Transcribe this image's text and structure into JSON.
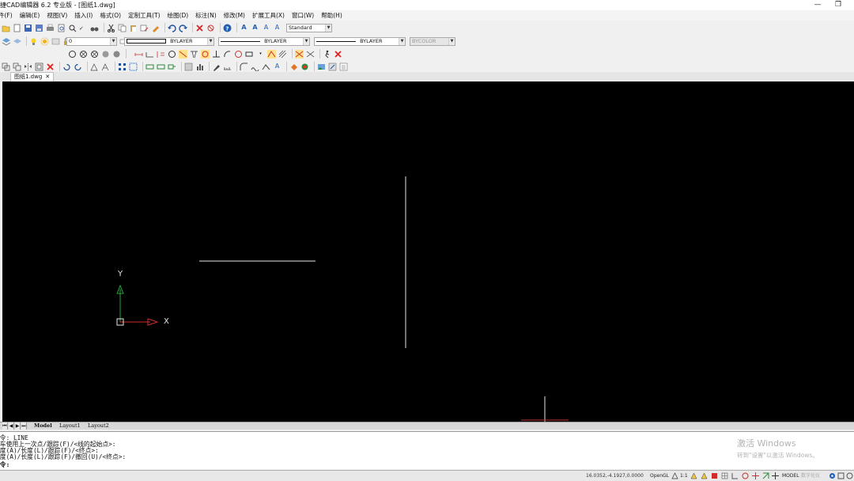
{
  "titlebar": {
    "title": "捷CAD编辑器 6.2 专业版 - [图纸1.dwg]",
    "minimize_label": "—",
    "restore_label": "❐"
  },
  "menus": [
    "件(F)",
    "编辑(E)",
    "视图(V)",
    "插入(I)",
    "格式(O)",
    "定制工具(T)",
    "绘图(D)",
    "标注(N)",
    "修改(M)",
    "扩展工具(X)",
    "窗口(W)",
    "帮助(H)"
  ],
  "toolbar1": {
    "text_style_value": "Standard"
  },
  "toolbar2": {
    "layer_value": "0",
    "color_value": "BYLAYER",
    "linetype_value": "BYLAYER",
    "lineweight_value": "BYLAYER",
    "plotstyle_value": "BYCOLOR"
  },
  "doc_tab": {
    "label": "图纸1.dwg",
    "close": "✕"
  },
  "ucs": {
    "x_label": "X",
    "y_label": "Y"
  },
  "layout_tabs": {
    "tabs": [
      "Model",
      "Layout1",
      "Layout2"
    ],
    "active": "Model"
  },
  "command": {
    "history": [
      "命令:   LINE",
      "回车使用上一次点/跟踪(F)/<线的起始点>:",
      "角度(A)/长度(L)/跟踪(F)/<终点>:",
      "角度(A)/长度(L)/跟踪(F)/撤回(U)/<终点>:"
    ],
    "prompt": "命令:"
  },
  "watermark": {
    "line1": "激活 Windows",
    "line2": "转到\"设置\"以激活 Windows。"
  },
  "statusbar": {
    "coordinates": "16.0352,-4.1927,0.0000",
    "renderer": "OpenGL",
    "scale": "1:1",
    "space": "MODEL",
    "extra": "数字化仪"
  },
  "colors": {
    "canvas_bg": "#000000",
    "ucs_x": "#d12b2b",
    "ucs_y": "#27a33a",
    "drawing_line": "#e6e6e6",
    "cursor": "#c23535"
  }
}
